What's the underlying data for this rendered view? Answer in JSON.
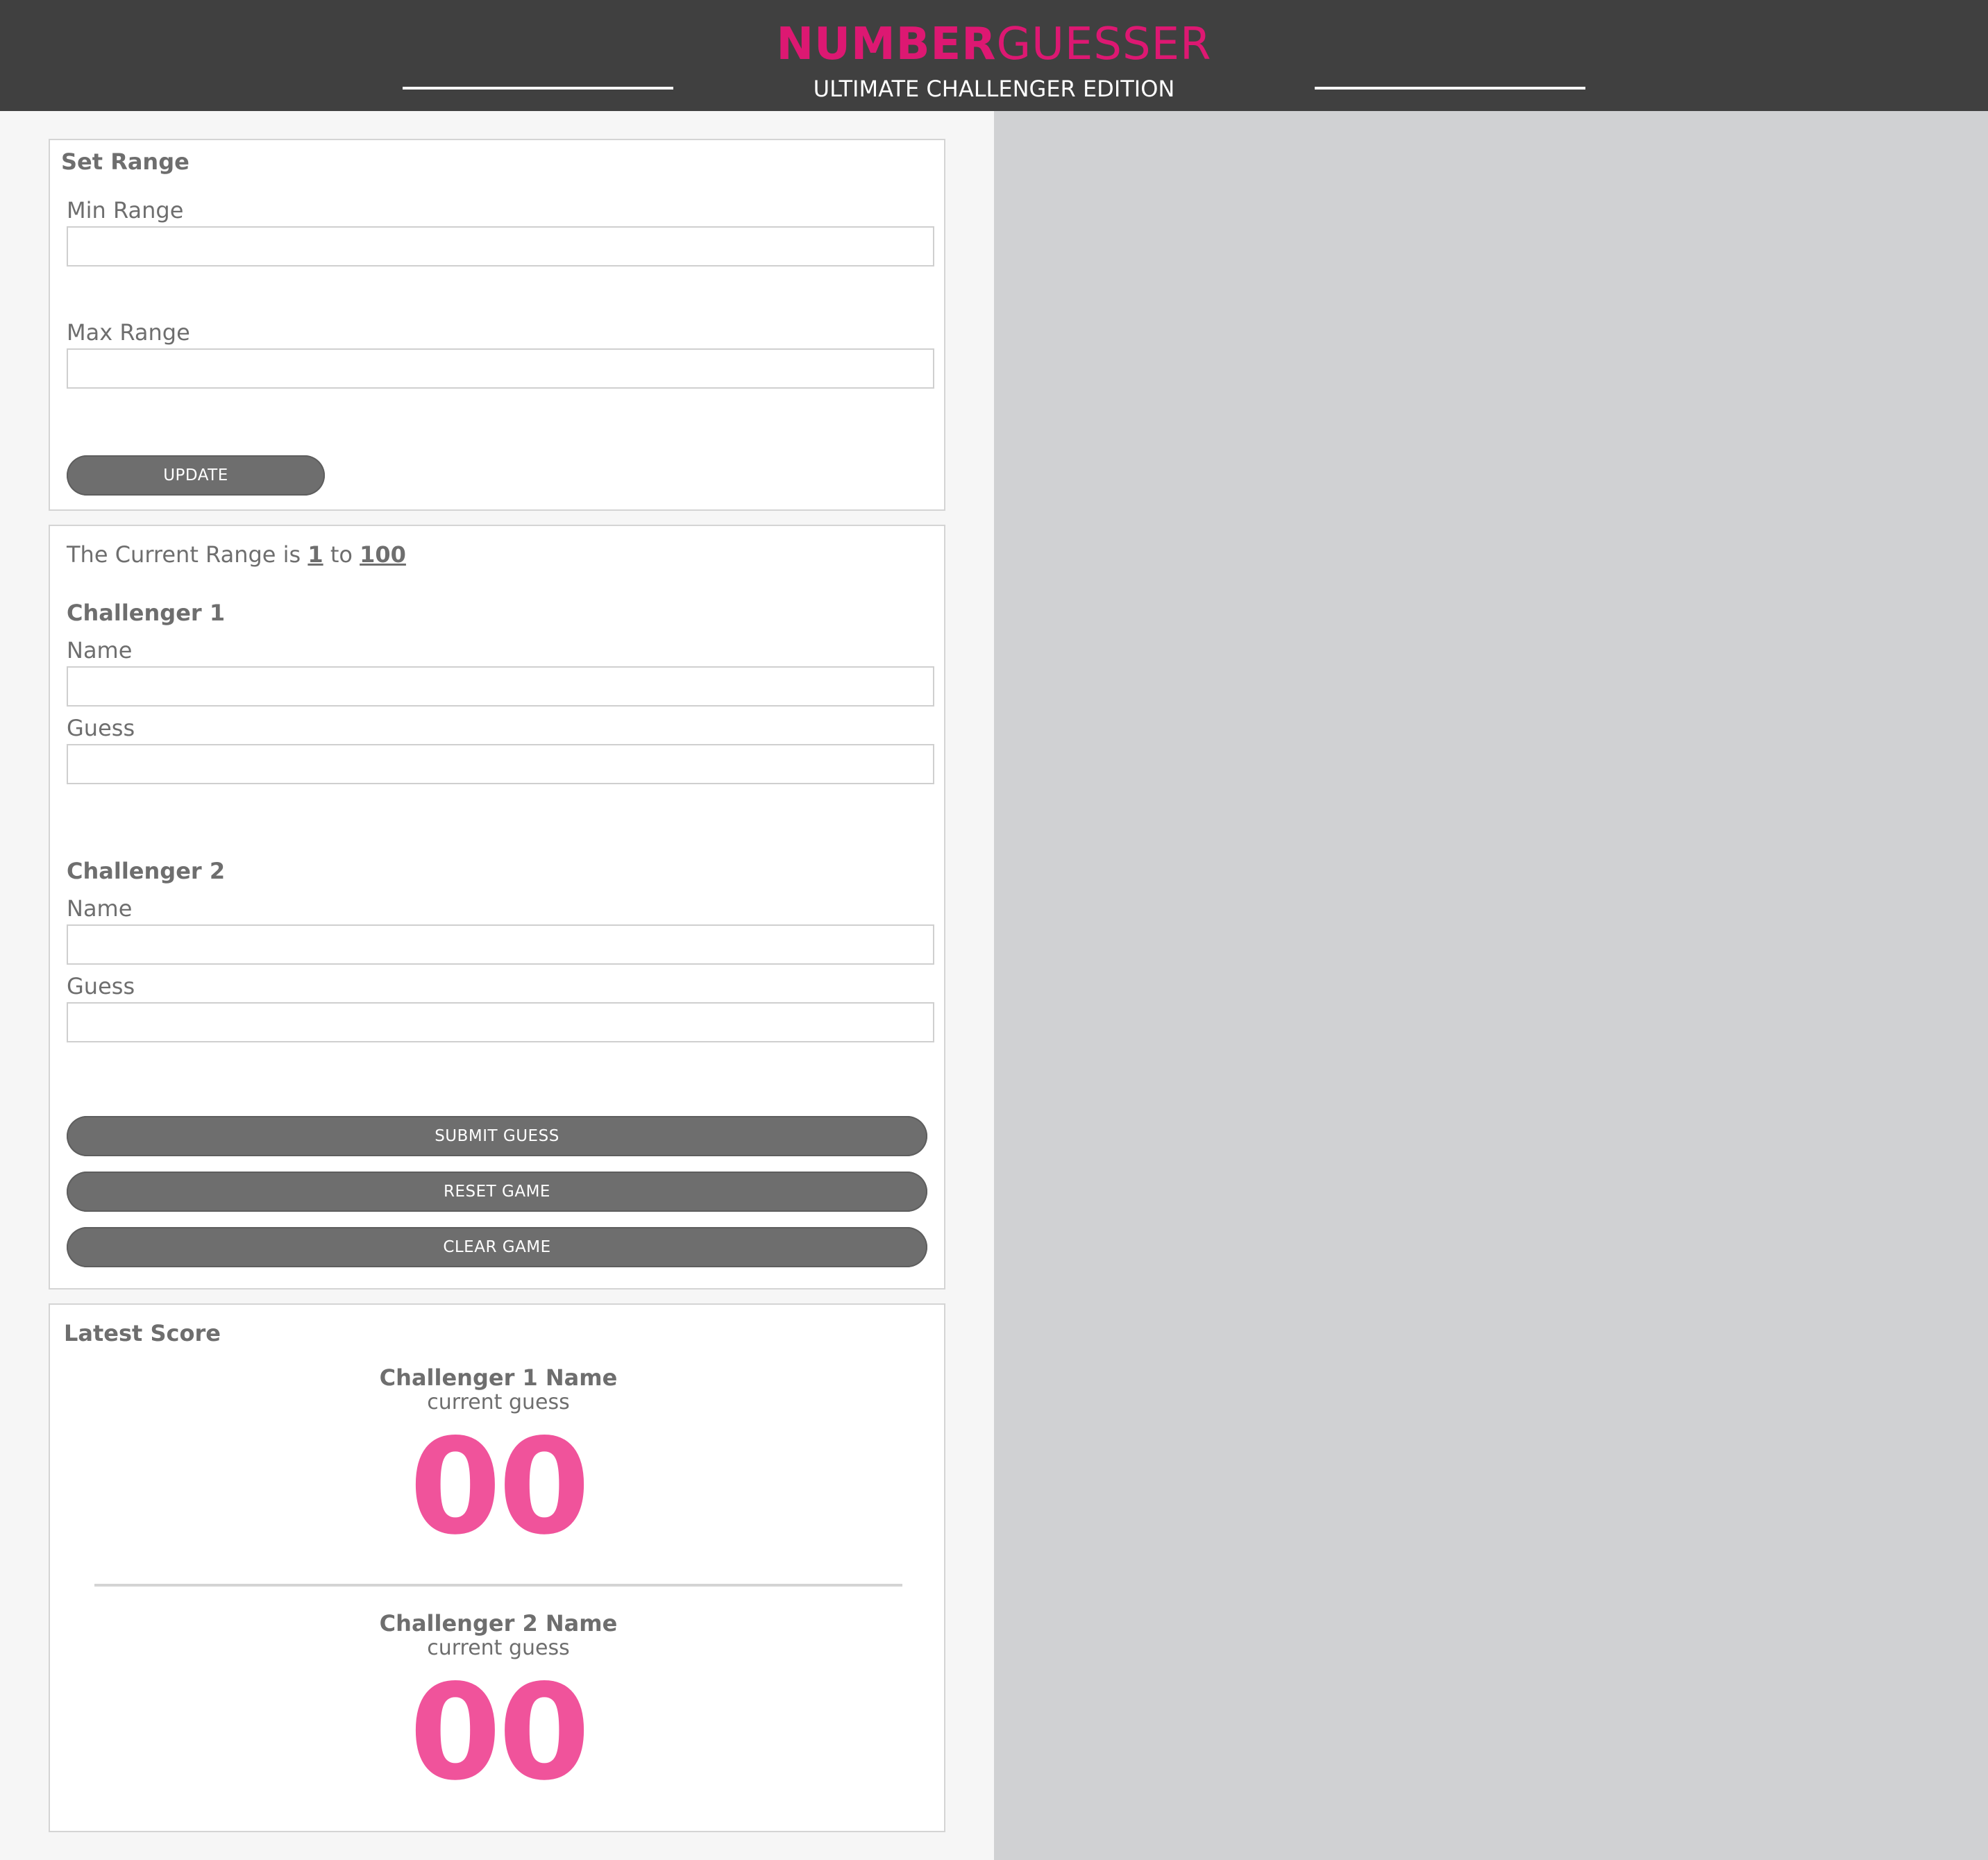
{
  "header": {
    "brand_bold": "NUMBER",
    "brand_light": "GUESSER",
    "subtitle": "ULTIMATE CHALLENGER EDITION",
    "brand_color": "#dd1872",
    "background": "#404040"
  },
  "set_range": {
    "title": "Set Range",
    "min_label": "Min Range",
    "min_value": "",
    "max_label": "Max Range",
    "max_value": "",
    "update_button": "UPDATE"
  },
  "game": {
    "range_prefix": "The Current Range is",
    "range_min": "1",
    "range_joiner": "to",
    "range_max": "100",
    "challenger1": {
      "title": "Challenger 1",
      "name_label": "Name",
      "name_value": "",
      "guess_label": "Guess",
      "guess_value": ""
    },
    "challenger2": {
      "title": "Challenger 2",
      "name_label": "Name",
      "name_value": "",
      "guess_label": "Guess",
      "guess_value": ""
    },
    "submit_button": "SUBMIT GUESS",
    "reset_button": "RESET GAME",
    "clear_button": "CLEAR GAME"
  },
  "latest_score": {
    "title": "Latest Score",
    "challenger1_name": "Challenger 1 Name",
    "challenger1_sub": "current guess",
    "challenger1_guess": "00",
    "challenger2_name": "Challenger 2 Name",
    "challenger2_sub": "current guess",
    "challenger2_guess": "00",
    "guess_color": "#f0539b"
  }
}
